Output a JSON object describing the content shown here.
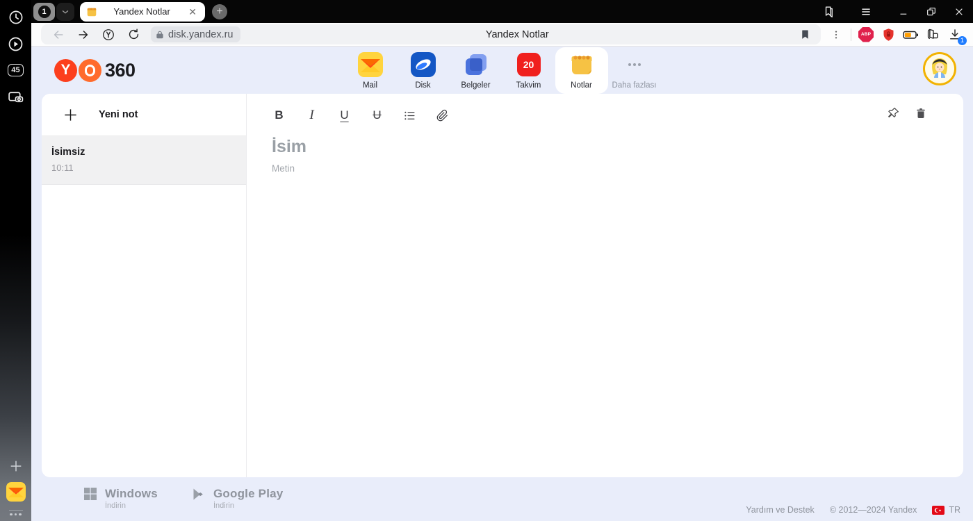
{
  "browser": {
    "sidebar_badge": "45",
    "tab_count": "1",
    "tab_title": "Yandex Notlar",
    "new_tab_label": "+",
    "url": "disk.yandex.ru",
    "page_title": "Yandex Notlar",
    "adblock_label": "ABP",
    "download_badge": "1"
  },
  "header": {
    "logo_text": "360",
    "services": [
      {
        "label": "Mail"
      },
      {
        "label": "Disk"
      },
      {
        "label": "Belgeler"
      },
      {
        "label": "Takvim",
        "badge": "20"
      },
      {
        "label": "Notlar",
        "active": true
      },
      {
        "label": "Daha fazlası"
      }
    ]
  },
  "notes": {
    "new_note_label": "Yeni not",
    "items": [
      {
        "title": "İsimsiz",
        "time": "10:11"
      }
    ]
  },
  "editor": {
    "toolbar": {
      "bold": "B",
      "italic": "I",
      "underline": "U",
      "strikethrough": "U"
    },
    "title_placeholder": "İsim",
    "body_placeholder": "Metin"
  },
  "footer": {
    "windows": {
      "title": "Windows",
      "subtitle": "İndirin"
    },
    "google_play": {
      "title": "Google Play",
      "subtitle": "İndirin"
    },
    "help": "Yardım ve Destek",
    "copyright": "© 2012—2024 Yandex",
    "lang": "TR"
  },
  "colors": {
    "accent_red": "#fc3f1d",
    "accent_orange": "#ff6b2c",
    "header_bg": "#e9edfa",
    "calendar_red": "#f0201e",
    "notes_yellow": "#f6c244",
    "download_badge_blue": "#1f7cff",
    "flag_red": "#e30a17"
  }
}
